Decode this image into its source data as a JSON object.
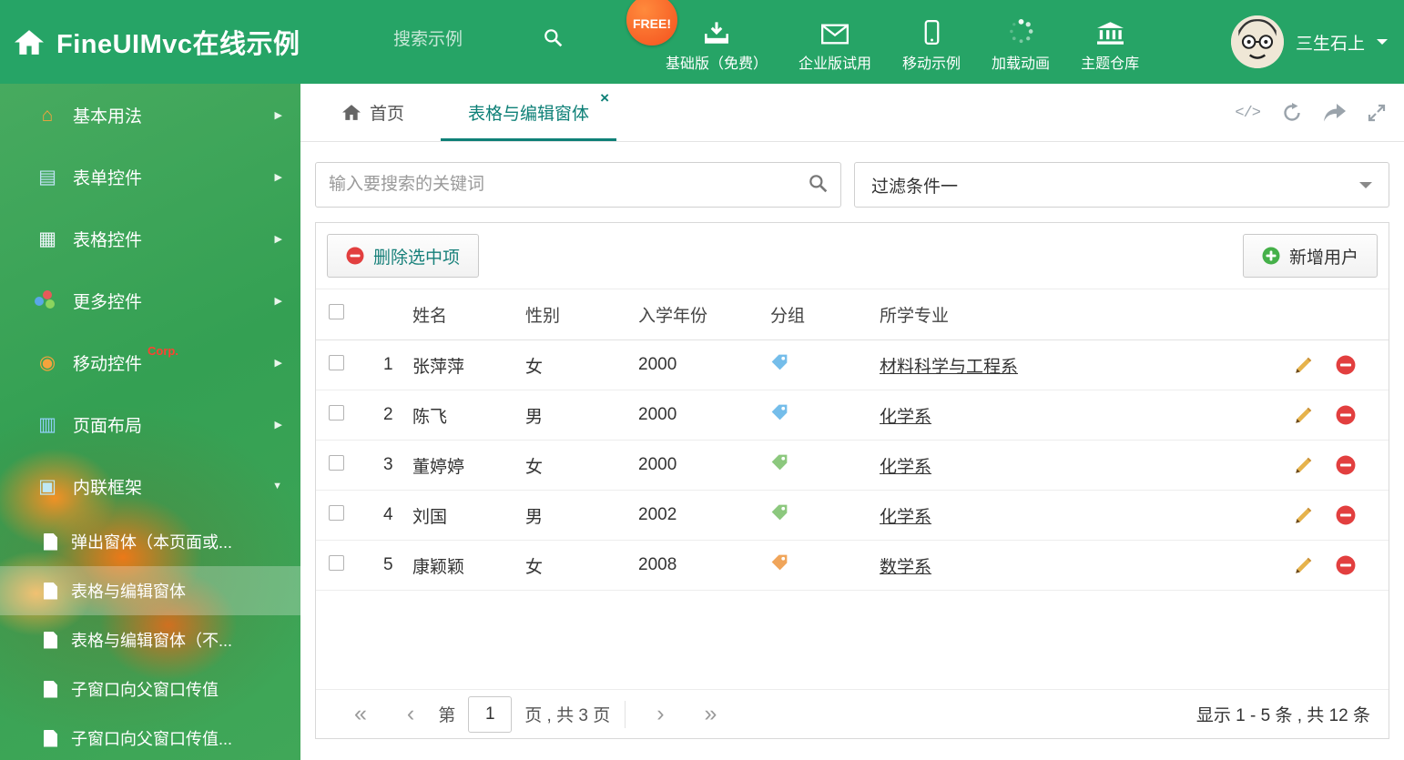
{
  "header": {
    "title": "FineUIMvc在线示例",
    "search_placeholder": "搜索示例",
    "free_badge": "FREE!",
    "nav_items": [
      {
        "label": "基础版（免费）",
        "icon": "download-icon"
      },
      {
        "label": "企业版试用",
        "icon": "envelope-icon"
      },
      {
        "label": "移动示例",
        "icon": "mobile-icon"
      },
      {
        "label": "加载动画",
        "icon": "spinner-icon"
      },
      {
        "label": "主题仓库",
        "icon": "bank-icon"
      }
    ],
    "user_name": "三生石上"
  },
  "sidebar": {
    "items": [
      {
        "label": "基本用法",
        "icon": "home-icon",
        "glyph": "⌂"
      },
      {
        "label": "表单控件",
        "icon": "form-icon",
        "glyph": "▤"
      },
      {
        "label": "表格控件",
        "icon": "table-icon",
        "glyph": "▦"
      },
      {
        "label": "更多控件",
        "icon": "widgets-icon",
        "glyph": ""
      },
      {
        "label": "移动控件",
        "icon": "mobile-icon",
        "glyph": "◉",
        "badge": "Corp."
      },
      {
        "label": "页面布局",
        "icon": "layout-icon",
        "glyph": "▥"
      },
      {
        "label": "内联框架",
        "icon": "iframe-icon",
        "glyph": "▣"
      }
    ],
    "sub_items": [
      {
        "label": "弹出窗体（本页面或..."
      },
      {
        "label": "表格与编辑窗体",
        "active": true
      },
      {
        "label": "表格与编辑窗体（不..."
      },
      {
        "label": "子窗口向父窗口传值"
      },
      {
        "label": "子窗口向父窗口传值..."
      }
    ]
  },
  "tabs": {
    "home": "首页",
    "active": "表格与编辑窗体",
    "close_glyph": "×"
  },
  "content": {
    "search_placeholder": "输入要搜索的关键词",
    "filter_value": "过滤条件一",
    "delete_button": "删除选中项",
    "add_button": "新增用户"
  },
  "table": {
    "columns": {
      "name": "姓名",
      "gender": "性别",
      "year": "入学年份",
      "group": "分组",
      "major": "所学专业"
    },
    "rows": [
      {
        "num": "1",
        "name": "张萍萍",
        "gender": "女",
        "year": "2000",
        "tag_color": "#74bdea",
        "major": "材料科学与工程系"
      },
      {
        "num": "2",
        "name": "陈飞",
        "gender": "男",
        "year": "2000",
        "tag_color": "#74bdea",
        "major": "化学系"
      },
      {
        "num": "3",
        "name": "董婷婷",
        "gender": "女",
        "year": "2000",
        "tag_color": "#8cc87e",
        "major": "化学系"
      },
      {
        "num": "4",
        "name": "刘国",
        "gender": "男",
        "year": "2002",
        "tag_color": "#8cc87e",
        "major": "化学系"
      },
      {
        "num": "5",
        "name": "康颖颖",
        "gender": "女",
        "year": "2008",
        "tag_color": "#f0a55a",
        "major": "数学系"
      }
    ]
  },
  "pagination": {
    "first": "«",
    "prev": "‹",
    "page_label_before": "第",
    "current_page": "1",
    "page_label_after": "页 , 共 3 页",
    "next": "›",
    "last": "»",
    "summary": "显示 1 - 5 条 , 共 12 条"
  },
  "colors": {
    "header_green": "#26a466",
    "accent_teal": "#0e8077",
    "delete_red": "#e23f3f",
    "add_green": "#45b049"
  }
}
